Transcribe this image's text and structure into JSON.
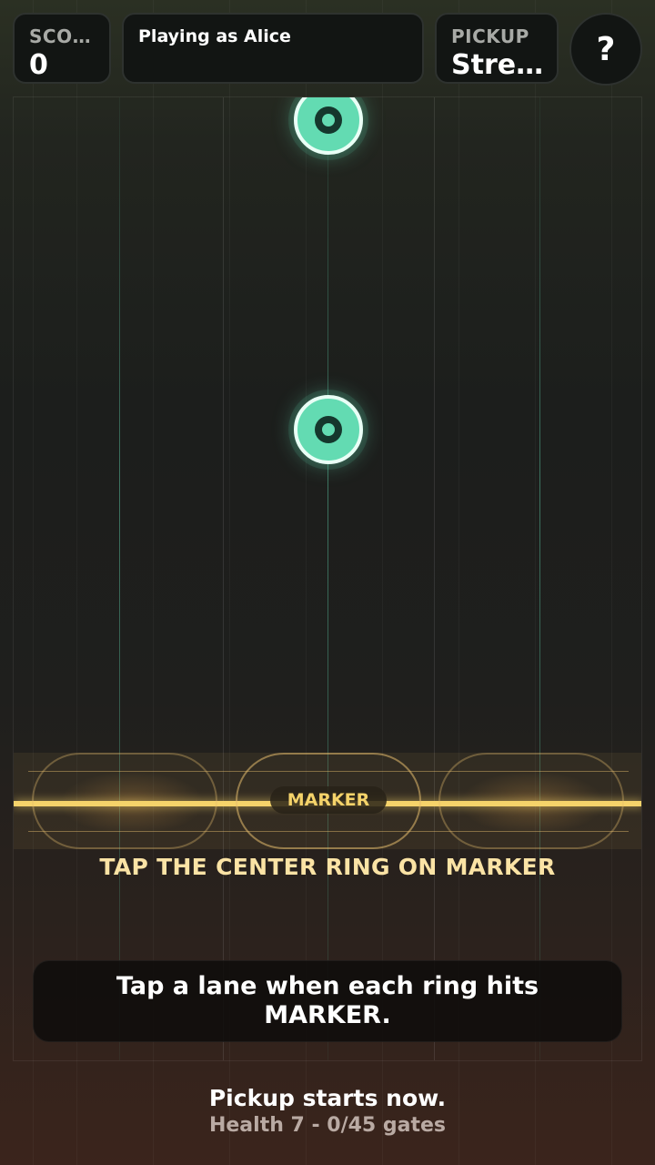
{
  "hud": {
    "score_label": "SCORE",
    "score_value": "0",
    "player_text": "Playing as Alice",
    "mode_label": "PICKUP",
    "mode_value": "Streak",
    "help_label": "?"
  },
  "playfield": {
    "marker_label": "MARKER",
    "instruction": "TAP THE CENTER RING ON MARKER",
    "tip": "Tap a lane when each ring hits MARKER."
  },
  "status": {
    "headline": "Pickup starts now.",
    "detail": "Health 7 - 0/45 gates"
  },
  "colors": {
    "ring": "#63dbb2",
    "marker": "#f5d36a",
    "instruction": "#fbe3a5"
  }
}
